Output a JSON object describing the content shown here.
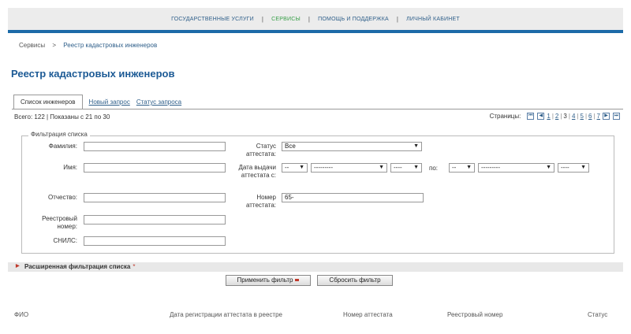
{
  "topnav": {
    "items": [
      "ГОСУДАРСТВЕННЫЕ УСЛУГИ",
      "СЕРВИСЫ",
      "ПОМОЩЬ И ПОДДЕРЖКА",
      "ЛИЧНЫЙ КАБИНЕТ"
    ],
    "separator": "|",
    "active_color": "#3aa04a",
    "link_color": "#2f5f8a"
  },
  "breadcrumb": {
    "root": "Сервисы",
    "arrow": ">",
    "current": "Реестр кадастровых инженеров"
  },
  "page_title": "Реестр кадастровых инженеров",
  "tabs": {
    "active": "Список инженеров",
    "new_request": "Новый запрос",
    "request_status": "Статус запроса"
  },
  "summary": "Всего: 122 | Показаны с 21 по 30",
  "pager": {
    "label": "Страницы:",
    "first_icon": "first-page-icon",
    "prev_icon": "prev-page-icon",
    "next_icon": "next-page-icon",
    "last_icon": "last-page-icon",
    "pages": [
      "1",
      "2",
      "3",
      "4",
      "5",
      "6",
      "7"
    ],
    "current": "3",
    "separator": "|"
  },
  "filter": {
    "legend": "Фильтрация списка",
    "surname_label": "Фамилия:",
    "name_label": "Имя:",
    "patronymic_label": "Отчество:",
    "registry_label": "Реестровый номер:",
    "snils_label": "СНИЛС:",
    "status_label": "Статус аттестата:",
    "status_value": "Все",
    "issue_date_label": "Дата выдачи аттестата с:",
    "day_from": "--",
    "month_from": "---------",
    "year_from": "----",
    "to_label": "по:",
    "day_to": "--",
    "month_to": "---------",
    "year_to": "----",
    "cert_number_label": "Номер аттестата:",
    "cert_number_value": "65-"
  },
  "extended_filter": {
    "label": "Расширенная фильтрация списка",
    "star": "*"
  },
  "buttons": {
    "apply": "Применить фильтр",
    "reset": "Сбросить фильтр"
  },
  "table": {
    "columns": [
      "ФИО",
      "Дата регистрации аттестата в реестре",
      "Номер аттестата",
      "Реестровый номер",
      "Статус"
    ]
  },
  "colors": {
    "accent_blue": "#1c6aa8",
    "title_blue": "#1c5a95",
    "link_blue": "#2f5f8a",
    "marker_red": "#c0392b"
  }
}
